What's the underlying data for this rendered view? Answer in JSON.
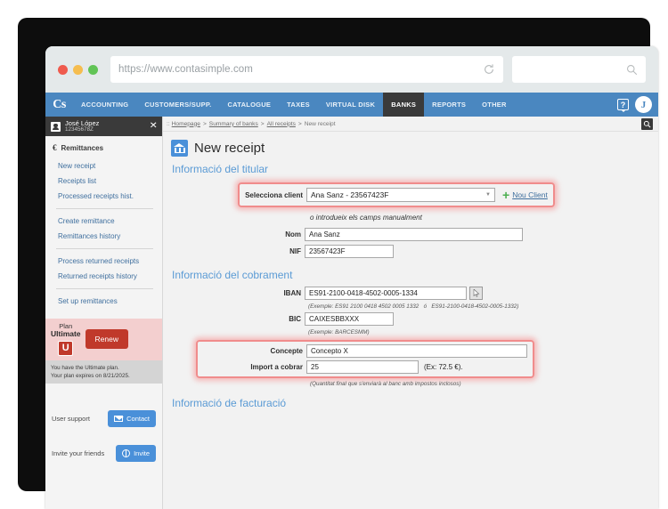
{
  "browser": {
    "url": "https://www.contasimple.com",
    "url_placeholder": "https://www.contasimple.com",
    "search_placeholder": "",
    "reload_icon": "reload-icon",
    "search_icon": "magnifier-icon"
  },
  "topnav": {
    "brand": "Cs",
    "items": [
      {
        "label": "ACCOUNTING",
        "active": false
      },
      {
        "label": "CUSTOMERS/SUPP.",
        "active": false
      },
      {
        "label": "CATALOGUE",
        "active": false
      },
      {
        "label": "TAXES",
        "active": false
      },
      {
        "label": "VIRTUAL DISK",
        "active": false
      },
      {
        "label": "BANKS",
        "active": true
      },
      {
        "label": "REPORTS",
        "active": false
      },
      {
        "label": "OTHER",
        "active": false
      }
    ],
    "help_label": "?",
    "avatar_initial": "J",
    "accent_color": "#4a87c0",
    "active_color": "#3a3a3a"
  },
  "sidebar": {
    "user": {
      "name": "José López",
      "nif": "12345678Z",
      "collapse_icon": "collapse-icon"
    },
    "section_title": "Remittances",
    "groups": [
      {
        "items": [
          "New receipt",
          "Receipts list",
          "Processed receipts hist."
        ]
      },
      {
        "items": [
          "Create remittance",
          "Remittances history"
        ]
      },
      {
        "items": [
          "Process returned receipts",
          "Returned receipts history"
        ]
      },
      {
        "items": [
          "Set up remittances"
        ]
      }
    ],
    "plan": {
      "word": "Plan",
      "name": "Ultimate",
      "badge": "U",
      "renew_label": "Renew",
      "note_line1": "You have the Ultimate plan.",
      "note_line2": "Your plan expires on 8/21/2025.",
      "box_color": "#f3cfcf",
      "button_color": "#c0392b"
    },
    "support": {
      "label": "User support",
      "button": "Contact"
    },
    "invite": {
      "label": "Invite your friends",
      "button": "Invite"
    }
  },
  "breadcrumb": {
    "prefix": "::",
    "items": [
      "Homepage",
      "Summary of banks",
      "All receipts",
      "New receipt"
    ],
    "separator": ">",
    "search_icon": "search-icon"
  },
  "page": {
    "title": "New receipt",
    "icon": "bank-icon"
  },
  "sections": {
    "titular": {
      "heading": "Informació del titular",
      "select_label": "Selecciona client",
      "select_value": "Ana Sanz - 23567423F",
      "new_client_label": "Nou Client",
      "manual_note": "o introdueix els camps manualment",
      "nom_label": "Nom",
      "nom_value": "Ana Sanz",
      "nif_label": "NIF",
      "nif_value": "23567423F"
    },
    "cobrament": {
      "heading": "Informació del cobrament",
      "iban_label": "IBAN",
      "iban_value": "ES91-2100-0418-4502-0005-1334",
      "iban_hint_prefix": "(Exemple:",
      "iban_hint_a": "ES91 2100 0418 4502 0005 1332",
      "iban_hint_or": "ó",
      "iban_hint_b": "ES91-2100-0418-4502-0005-1332)",
      "bic_label": "BIC",
      "bic_value": "CAIXESBBXXX",
      "bic_hint": "(Exemple: BARCESMM)",
      "concepte_label": "Concepte",
      "concepte_value": "Concepto X",
      "import_label": "Import a cobrar",
      "import_value": "25",
      "import_after": "(Ex: 72.5 €).",
      "import_hint": "(Quantitat final que s'enviarà al banc amb impostos inclosos)"
    },
    "facturacio": {
      "heading": "Informació de facturació"
    }
  },
  "highlight_color": "#f08c8c"
}
